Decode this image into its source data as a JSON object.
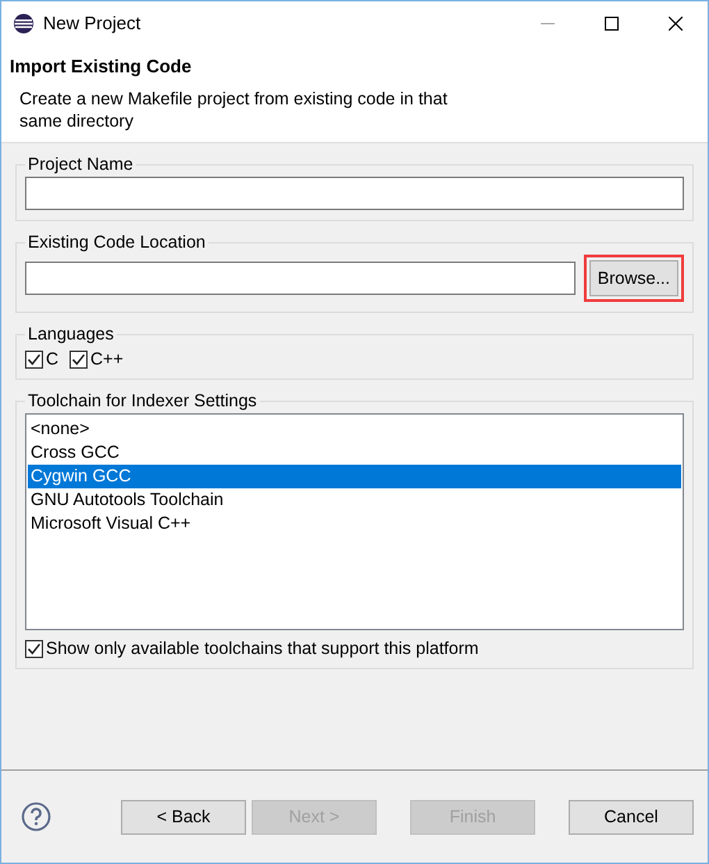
{
  "window": {
    "title": "New Project"
  },
  "header": {
    "title": "Import Existing Code",
    "description": "Create a new Makefile project from existing code in that same directory"
  },
  "project_name": {
    "label": "Project Name"
  },
  "code_location": {
    "label": "Existing Code Location",
    "browse": {
      "label": "Browse...",
      "highlighted": true
    }
  },
  "languages": {
    "label": "Languages",
    "items": [
      {
        "label": "C",
        "checked": true
      },
      {
        "label": "C++",
        "checked": true
      }
    ]
  },
  "toolchain": {
    "label": "Toolchain for Indexer Settings",
    "items": [
      {
        "label": "<none>",
        "selected": false
      },
      {
        "label": "Cross GCC",
        "selected": false
      },
      {
        "label": "Cygwin GCC",
        "selected": true
      },
      {
        "label": "GNU Autotools Toolchain",
        "selected": false
      },
      {
        "label": "Microsoft Visual C++",
        "selected": false
      }
    ],
    "filter": {
      "label": "Show only available toolchains that support this platform",
      "checked": true
    }
  },
  "buttons": [
    {
      "label": "< Back",
      "disabled": false
    },
    {
      "label": "Next >",
      "disabled": true
    },
    {
      "label": "Finish",
      "disabled": true
    },
    {
      "label": "Cancel",
      "disabled": false
    }
  ]
}
